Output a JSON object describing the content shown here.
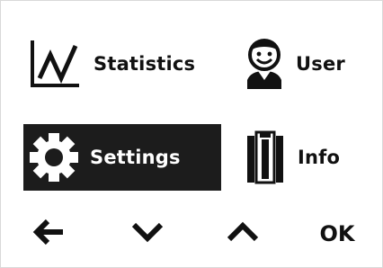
{
  "menu": {
    "items": [
      {
        "label": "Statistics",
        "icon": "line-chart-icon",
        "selected": false
      },
      {
        "label": "User",
        "icon": "user-icon",
        "selected": false
      },
      {
        "label": "Settings",
        "icon": "gear-icon",
        "selected": true
      },
      {
        "label": "Info",
        "icon": "info-device-icon",
        "selected": false
      }
    ]
  },
  "navigation": {
    "back_icon": "arrow-left-icon",
    "down_icon": "chevron-down-icon",
    "up_icon": "chevron-up-icon",
    "ok_label": "OK"
  },
  "colors": {
    "background": "#ffffff",
    "foreground": "#111111",
    "selected_background": "#1c1c1c",
    "selected_foreground": "#ffffff"
  }
}
